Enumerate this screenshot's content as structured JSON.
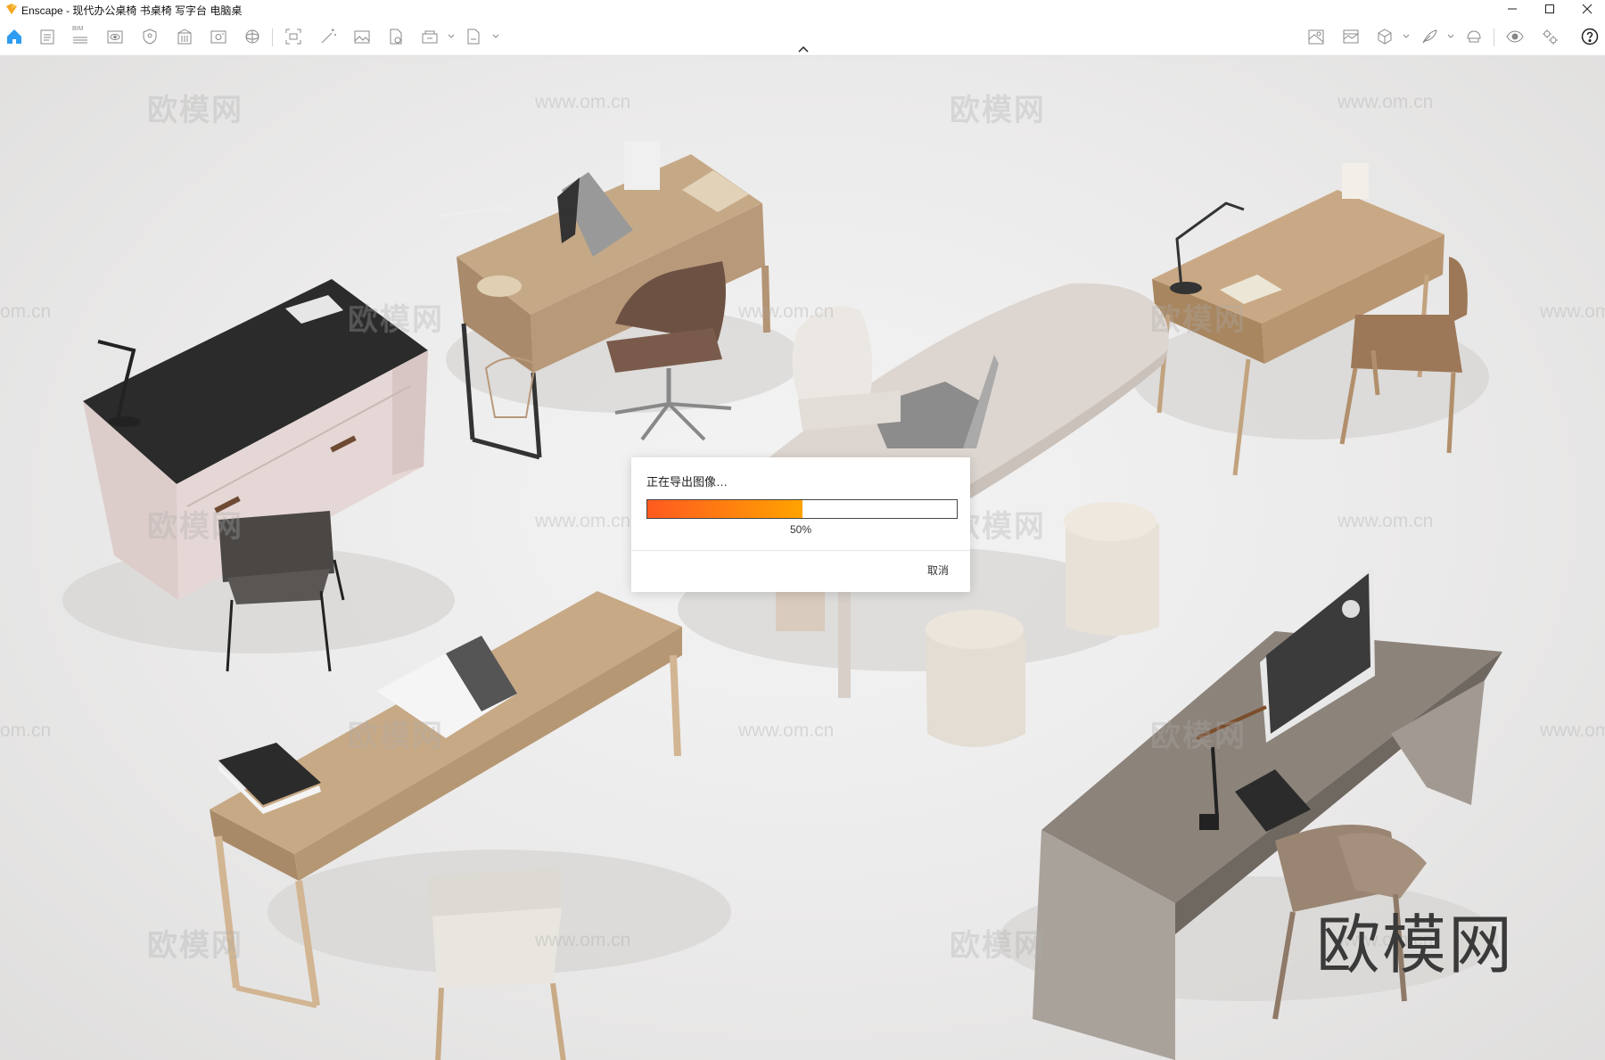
{
  "window": {
    "app_name": "Enscape",
    "title": "Enscape - 现代办公桌椅 书桌椅 写字台 电脑桌",
    "controls": [
      "minimize-icon",
      "maximize-icon",
      "close-icon"
    ]
  },
  "toolbar": {
    "left_tools": [
      "home-icon",
      "notes-icon",
      "bim-icon",
      "eye-view-icon",
      "shield-icon",
      "building-icon",
      "image-export-icon",
      "panorama-icon",
      "screenshot-icon",
      "magic-wand-icon",
      "picture-icon",
      "file-export-icon",
      "batch-render-icon",
      "exe-export-icon"
    ],
    "bim_label": "BIM",
    "right_tools": [
      "map-icon",
      "asset-library-icon",
      "cube-icon",
      "feather-icon",
      "helmet-icon",
      "visual-settings-icon",
      "settings-gear-icon",
      "help-icon"
    ]
  },
  "scene": {
    "watermark_cn": "欧模网",
    "watermark_url": "www.om.cn",
    "watermark_url_partial": "om.cn",
    "brand_mark": "欧模网",
    "colors": {
      "floor": "#e8e7e6",
      "wood_light": "#c9ab85",
      "wood_dark": "#a88660",
      "taupe": "#8a8178",
      "pink_desk": "#d9c8c6",
      "black_top": "#2b2b2b"
    }
  },
  "dialog": {
    "title": "正在导出图像…",
    "progress_percent": 50,
    "progress_label": "50%",
    "cancel_label": "取消",
    "progress_color_start": "#ff5a20",
    "progress_color_end": "#ffa300"
  }
}
